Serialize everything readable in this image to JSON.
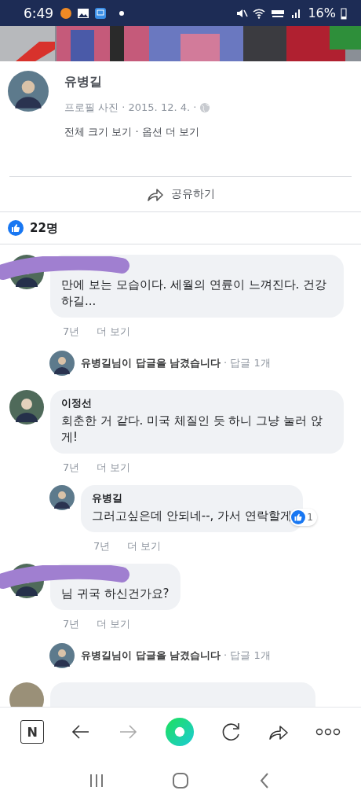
{
  "status_bar": {
    "time": "6:49",
    "battery": "16%"
  },
  "post": {
    "author": "유병길",
    "meta": "프로필 사진 · 2015. 12. 4. ·",
    "links": "전체 크기 보기 · 옵션 더 보기"
  },
  "share": {
    "label": "공유하기"
  },
  "likes": {
    "count": "22명"
  },
  "comments": [
    {
      "kind": "comment",
      "redacted": true,
      "text": "만에 보는 모습이다. 세월의 연륜이 느껴진다. 건강하길...",
      "time": "7년",
      "action": "더 보기"
    },
    {
      "kind": "reply_summary",
      "text": "유병길님이 답글을 남겼습니다",
      "count": "· 답글 1개"
    },
    {
      "kind": "comment",
      "redacted": false,
      "name": "이정선",
      "text": "회춘한 거 같다. 미국 체질인 듯 하니 그냥 눌러 앉게!",
      "time": "7년",
      "action": "더 보기"
    },
    {
      "kind": "reply",
      "name": "유병길",
      "text": "그러고싶은데 안되네--, 가서 연락할게",
      "reactions": "1",
      "time": "7년",
      "action": "더 보기"
    },
    {
      "kind": "comment",
      "redacted": true,
      "text": "님 귀국 하신건가요?",
      "time": "7년",
      "action": "더 보기"
    },
    {
      "kind": "reply_summary",
      "text": "유병길님이 답글을 남겼습니다",
      "count": "· 답글 1개"
    },
    {
      "kind": "partial"
    }
  ],
  "toolbar": {
    "logo": "N"
  }
}
